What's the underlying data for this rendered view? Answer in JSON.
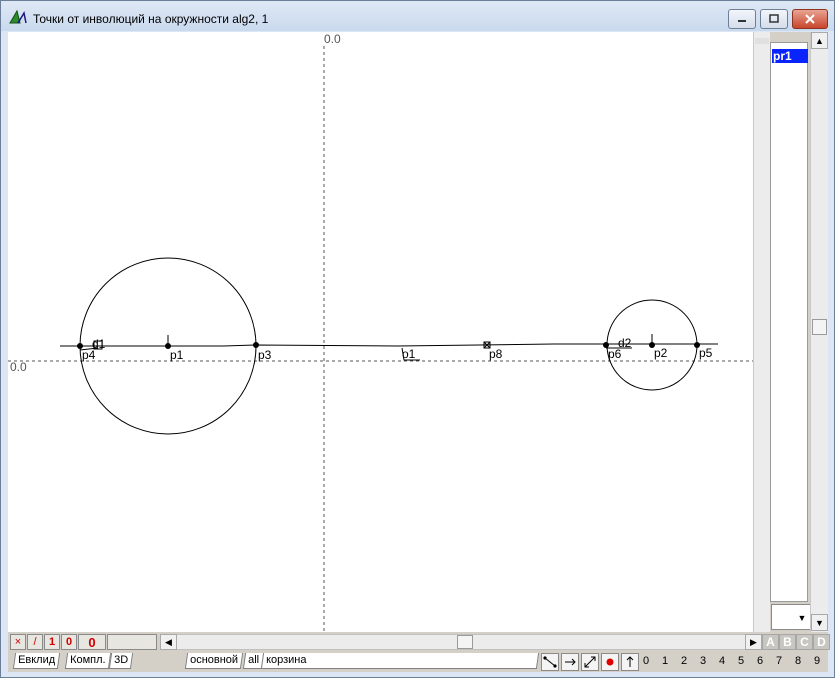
{
  "window": {
    "title": "Точки от инволюций на окружности alg2, 1",
    "minimize_icon": "minimize-icon",
    "maximize_icon": "maximize-icon",
    "close_icon": "close-icon"
  },
  "canvas": {
    "origin_label_x": "0.0",
    "origin_label_y": "0.0",
    "point_labels": [
      "p1",
      "p2",
      "p3",
      "p4",
      "p5",
      "p6",
      "p8"
    ],
    "line_labels": [
      "o1",
      "d1",
      "d2"
    ]
  },
  "layers_panel": {
    "items": [
      "pr1"
    ]
  },
  "status_bar": {
    "buttons": [
      "×",
      "/",
      "1",
      "0",
      "0"
    ],
    "column_buttons": [
      "A",
      "B",
      "C",
      "D"
    ]
  },
  "tabs_left": [
    "Евклид",
    "Компл.",
    "3D"
  ],
  "tabs_right": [
    "основной",
    "all",
    "корзина"
  ],
  "tools": {
    "icons": [
      "segment-tool-icon",
      "arrow-right-icon",
      "expand-icon",
      "point-tool-icon",
      "arrow-up-icon"
    ],
    "digits": [
      "0",
      "1",
      "2",
      "3",
      "4",
      "5",
      "6",
      "7",
      "8",
      "9"
    ]
  },
  "colors": {
    "selection": "#0a24ff",
    "status_red": "#d00000"
  }
}
